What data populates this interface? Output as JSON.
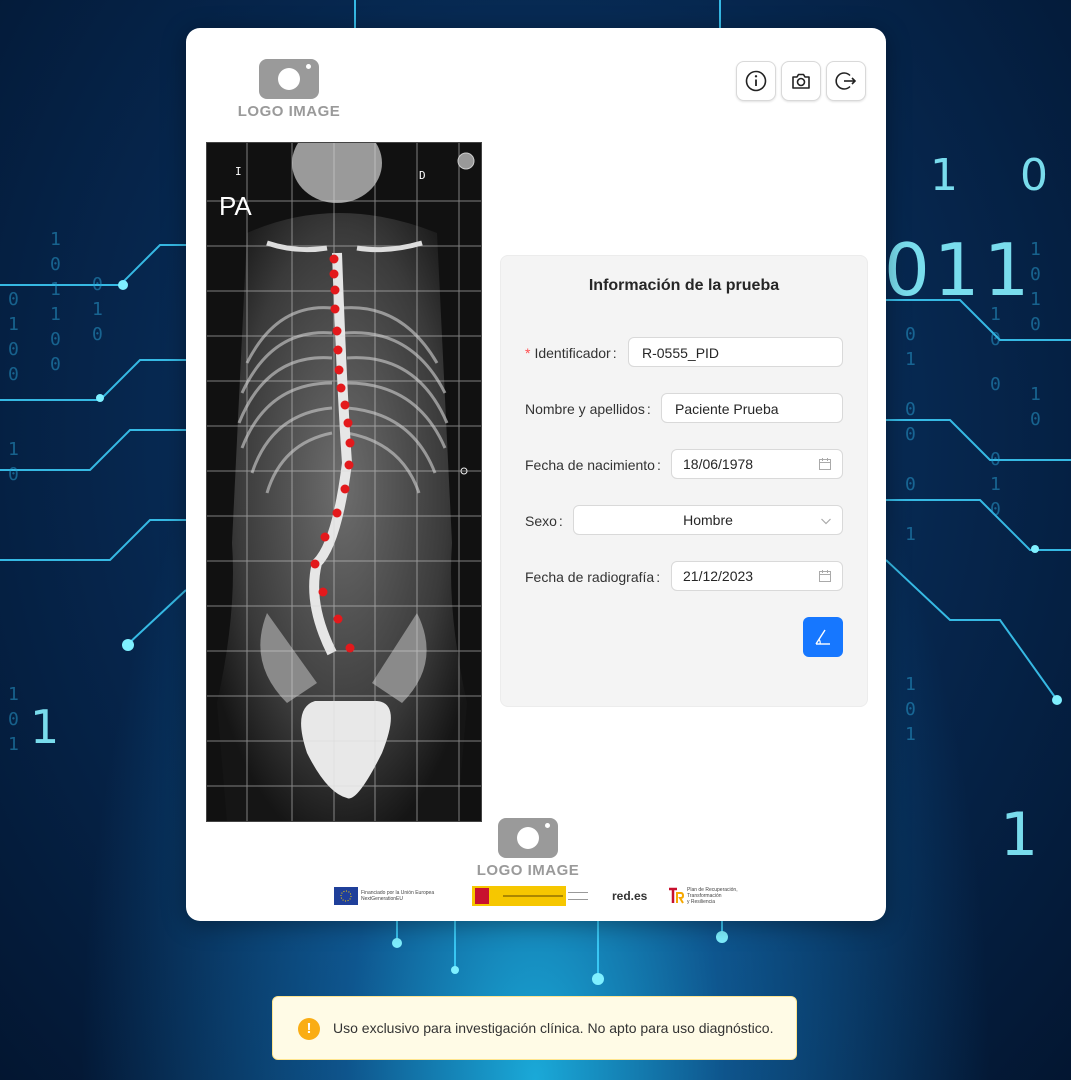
{
  "background": {
    "digits": [
      "1",
      "0",
      "0",
      "1",
      "1"
    ]
  },
  "header": {
    "logo_text": "LOGO IMAGE",
    "buttons": [
      {
        "name": "info-button",
        "icon": "info-icon"
      },
      {
        "name": "camera-button",
        "icon": "camera-icon"
      },
      {
        "name": "logout-button",
        "icon": "logout-icon"
      }
    ]
  },
  "xray": {
    "view_label": "PA",
    "marker_left": "I",
    "marker_right": "D"
  },
  "form": {
    "title": "Información de la prueba",
    "required_mark": "*",
    "identificador_label": "Identificador",
    "identificador_value": "R-0555_PID",
    "nombre_label": "Nombre y apellidos",
    "nombre_value": "Paciente Prueba",
    "fecha_nacimiento_label": "Fecha de nacimiento",
    "fecha_nacimiento_value": "18/06/1978",
    "sexo_label": "Sexo",
    "sexo_value": "Hombre",
    "fecha_radiografia_label": "Fecha de radiografía",
    "fecha_radiografia_value": "21/12/2023",
    "colon": ":",
    "angle_button_icon": "angle-measure-icon"
  },
  "footer": {
    "logo_text": "LOGO IMAGE",
    "eu_text_1": "Financiado por la Unión Europea",
    "eu_text_2": "NextGenerationEU",
    "redes_text": "red.es",
    "plan_text_1": "Plan de Recuperación,",
    "plan_text_2": "Transformación",
    "plan_text_3": "y Resiliencia"
  },
  "alert": {
    "icon": "warning-icon",
    "symbol": "!",
    "message": "Uso exclusivo para investigación clínica. No apto para uso diagnóstico."
  },
  "colors": {
    "primary": "#1677ff",
    "warning": "#faad14",
    "marker": "#e3191c"
  }
}
